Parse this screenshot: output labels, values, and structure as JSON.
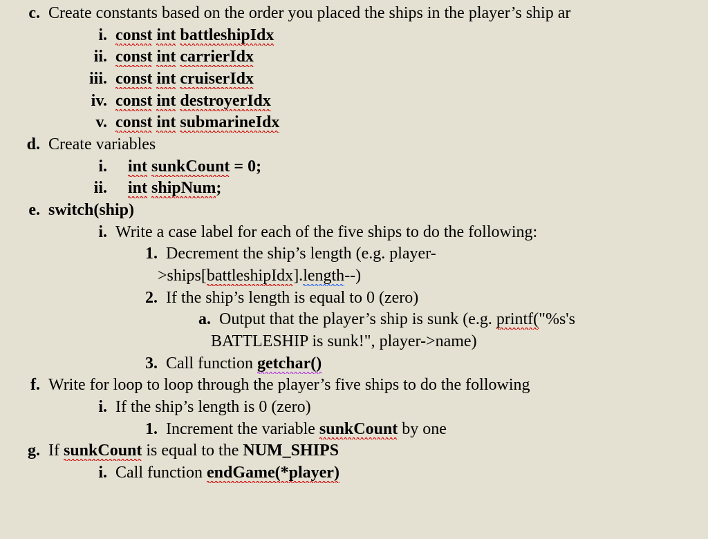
{
  "c": {
    "marker": "c.",
    "text": "Create constants based on the order you placed the ships in the player’s ship ar",
    "items": [
      {
        "marker": "i.",
        "kw1": "const",
        "kw2": "int",
        "ident": "battleshipIdx"
      },
      {
        "marker": "ii.",
        "kw1": "const",
        "kw2": "int",
        "ident": "carrierIdx"
      },
      {
        "marker": "iii.",
        "kw1": "const",
        "kw2": "int",
        "ident": "cruiserIdx"
      },
      {
        "marker": "iv.",
        "kw1": "const",
        "kw2": "int",
        "ident": "destroyerIdx"
      },
      {
        "marker": "v.",
        "kw1": "const",
        "kw2": "int",
        "ident": "submarineIdx"
      }
    ]
  },
  "d": {
    "marker": "d.",
    "text": "Create variables",
    "items": [
      {
        "marker": "i.",
        "kw": "int",
        "ident": "sunkCount",
        "rest": " = 0;"
      },
      {
        "marker": "ii.",
        "kw": "int",
        "ident": "shipNum",
        "rest": ";"
      }
    ]
  },
  "e": {
    "marker": "e.",
    "lead": "switch(ship)",
    "i": {
      "marker": "i.",
      "text": "Write a case label for each of the five ships to do the following:",
      "n1": {
        "marker": "1.",
        "line1_a": "Decrement the ship’s length (e.g. player-",
        "line2_a": ">ships[",
        "line2_ident": "battleshipIdx",
        "line2_b": "].",
        "line2_c": "length",
        "line2_d": "--)"
      },
      "n2": {
        "marker": "2.",
        "text": "If the ship’s length is equal to 0 (zero)",
        "a": {
          "marker": "a.",
          "line1_a": "Output that the player’s ship is sunk (e.g. ",
          "line1_call": "printf(",
          "line1_b": "\"%s's",
          "line2": "BATTLESHIP is sunk!\", player->name)"
        }
      },
      "n3": {
        "marker": "3.",
        "text_a": "Call function ",
        "call": "getchar()"
      }
    }
  },
  "f": {
    "marker": "f.",
    "text": "Write for loop to loop through the player’s five ships to do the following",
    "i": {
      "marker": "i.",
      "text": "If the ship’s length is 0 (zero)",
      "n1": {
        "marker": "1.",
        "text_a": "Increment the variable ",
        "ident": "sunkCount",
        "text_b": " by one"
      }
    }
  },
  "g": {
    "marker": "g.",
    "text_a": "If ",
    "ident": "sunkCount",
    "text_b": " is equal to the ",
    "const": "NUM_SHIPS",
    "i": {
      "marker": "i.",
      "text_a": "Call function ",
      "call": "endGame(*player)"
    }
  }
}
